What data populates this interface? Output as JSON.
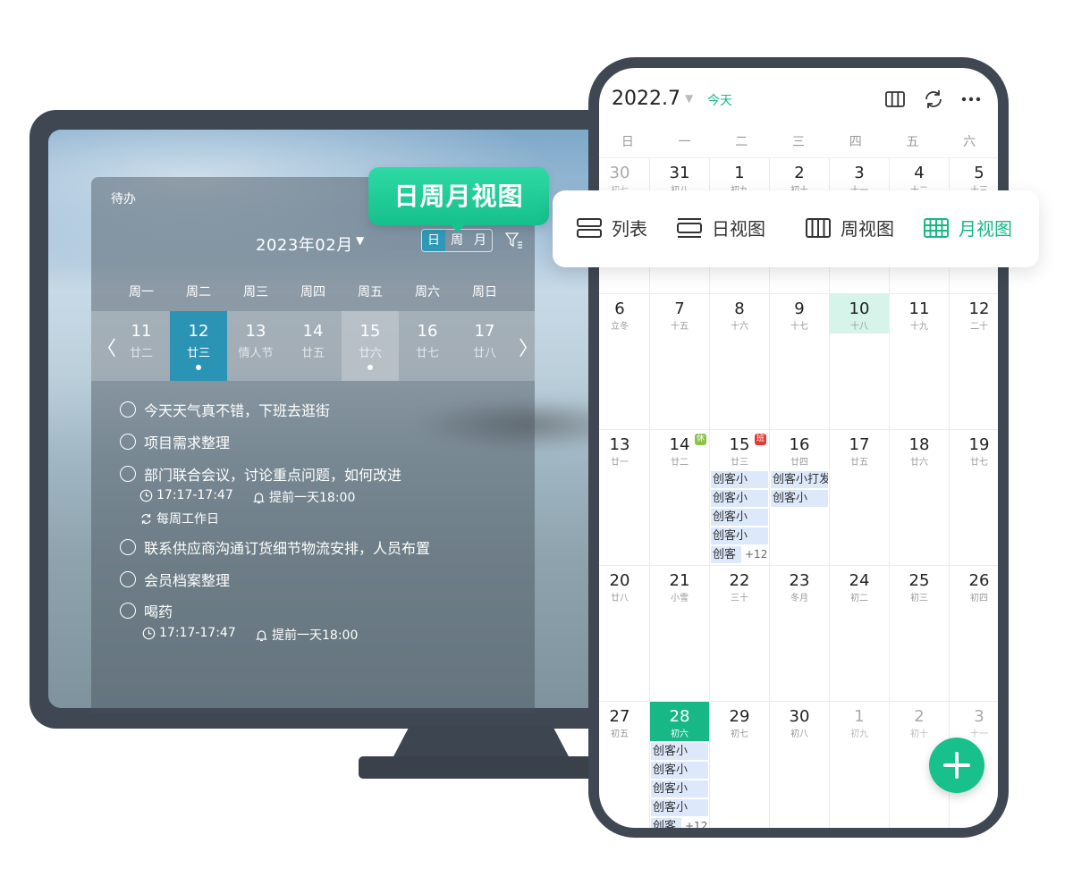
{
  "colors": {
    "accent": "#17b885",
    "selected_day": "#2b94b4",
    "frame": "#3f4752",
    "event_bg": "#dde9fb"
  },
  "callout": {
    "text": "日周月视图"
  },
  "desktop": {
    "panel_title": "待办",
    "month": "2023年02月",
    "view_toggle": [
      "日",
      "周",
      "月"
    ],
    "weekdays": [
      "周一",
      "周二",
      "周三",
      "周四",
      "周五",
      "周六",
      "周日"
    ],
    "days": [
      {
        "num": "11",
        "lunar": "廿二"
      },
      {
        "num": "12",
        "lunar": "廿三"
      },
      {
        "num": "13",
        "lunar": "情人节"
      },
      {
        "num": "14",
        "lunar": "廿五"
      },
      {
        "num": "15",
        "lunar": "廿六"
      },
      {
        "num": "16",
        "lunar": "廿七"
      },
      {
        "num": "17",
        "lunar": "廿八"
      }
    ],
    "tasks": [
      "今天天气真不错，下班去逛街",
      "项目需求整理",
      "部门联合会议，讨论重点问题，如何改进",
      "联系供应商沟通订货细节物流安排，人员布置",
      "会员档案整理",
      "喝药"
    ],
    "task_meta": {
      "time": "17:17-17:47",
      "reminder": "提前一天18:00",
      "repeat": "每周工作日"
    }
  },
  "phone": {
    "title": "2022.7",
    "today": "今天",
    "weekdays": [
      "日",
      "一",
      "二",
      "三",
      "四",
      "五",
      "六"
    ],
    "view_menu": [
      "列表",
      "日视图",
      "周视图",
      "月视图"
    ],
    "rows": [
      [
        {
          "n": "30",
          "l": "初七",
          "gray": true
        },
        {
          "n": "31",
          "l": "初八"
        },
        {
          "n": "1",
          "l": "初九"
        },
        {
          "n": "2",
          "l": "初十"
        },
        {
          "n": "3",
          "l": "十一"
        },
        {
          "n": "4",
          "l": "十二"
        },
        {
          "n": "5",
          "l": "十三"
        }
      ],
      [
        {
          "n": "6",
          "l": "立冬"
        },
        {
          "n": "7",
          "l": "十五"
        },
        {
          "n": "8",
          "l": "十六"
        },
        {
          "n": "9",
          "l": "十七"
        },
        {
          "n": "10",
          "l": "十八"
        },
        {
          "n": "11",
          "l": "十九"
        },
        {
          "n": "12",
          "l": "二十"
        }
      ],
      [
        {
          "n": "13",
          "l": "廿一"
        },
        {
          "n": "14",
          "l": "廿二"
        },
        {
          "n": "15",
          "l": "廿三"
        },
        {
          "n": "16",
          "l": "廿四"
        },
        {
          "n": "17",
          "l": "廿五"
        },
        {
          "n": "18",
          "l": "廿六"
        },
        {
          "n": "19",
          "l": "廿七"
        }
      ],
      [
        {
          "n": "20",
          "l": "廿八"
        },
        {
          "n": "21",
          "l": "小雪"
        },
        {
          "n": "22",
          "l": "三十"
        },
        {
          "n": "23",
          "l": "冬月"
        },
        {
          "n": "24",
          "l": "初二"
        },
        {
          "n": "25",
          "l": "初三"
        },
        {
          "n": "26",
          "l": "初四"
        }
      ],
      [
        {
          "n": "27",
          "l": "初五"
        },
        {
          "n": "28",
          "l": "初六"
        },
        {
          "n": "29",
          "l": "初七"
        },
        {
          "n": "30",
          "l": "初八"
        },
        {
          "n": "1",
          "l": "初九",
          "gray": true
        },
        {
          "n": "2",
          "l": "初十",
          "gray": true
        },
        {
          "n": "3",
          "l": "十一",
          "gray": true
        }
      ]
    ],
    "tags": {
      "rest": "休",
      "work": "班"
    },
    "events": {
      "d15": [
        "创客小",
        "创客小",
        "创客小",
        "创客小",
        "创客"
      ],
      "d16": [
        "创客小打发",
        "创客小"
      ],
      "d28": [
        "创客小",
        "创客小",
        "创客小",
        "创客小",
        "创客"
      ],
      "more": "+12"
    }
  }
}
